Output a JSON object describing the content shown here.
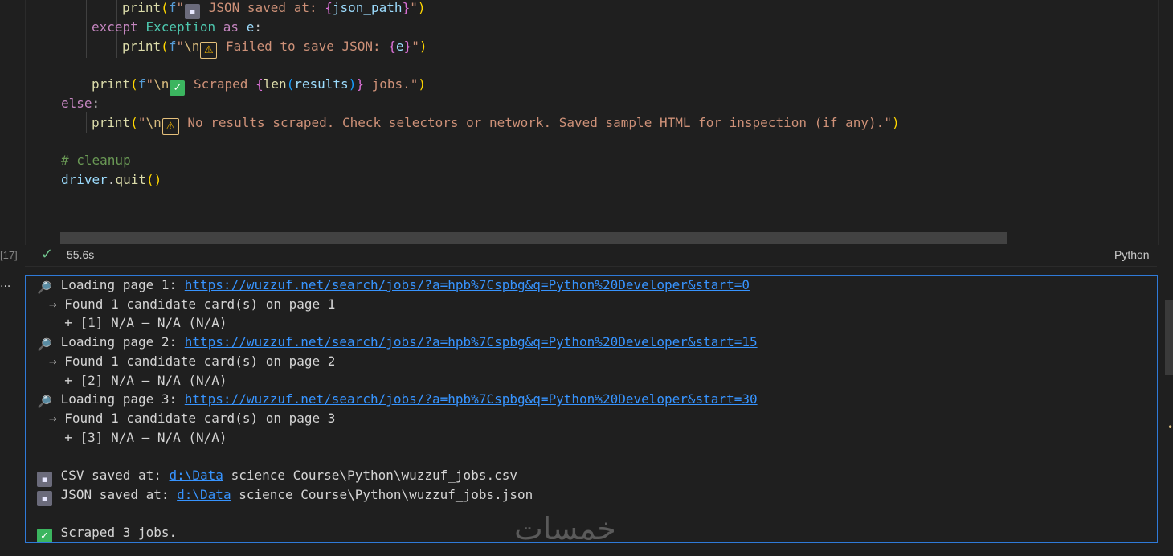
{
  "code": {
    "lines": [
      {
        "id": "json-saved-print"
      },
      {
        "id": "except-line"
      },
      {
        "id": "failed-print"
      },
      {
        "id": "scraped-print"
      },
      {
        "id": "else-line"
      },
      {
        "id": "no-results-print"
      },
      {
        "id": "comment-cleanup"
      },
      {
        "id": "driver-quit"
      }
    ],
    "t": {
      "print": "print",
      "f": "f",
      "json_saved_text": " JSON saved at: ",
      "json_path": "json_path",
      "except": "except",
      "Exception": "Exception",
      "as": "as",
      "e": "e",
      "failed_text": " Failed to save JSON: ",
      "scraped_text": " Scraped ",
      "len": "len",
      "results": "results",
      "jobs_text": " jobs.",
      "else": "else",
      "no_results_text": " No results scraped. Check selectors or network. Saved sample HTML for inspection (if any).",
      "comment": "# cleanup",
      "driver": "driver",
      "quit": "quit"
    }
  },
  "status": {
    "exec_count": "[17]",
    "duration": "55.6s",
    "language": "Python",
    "check_icon": "check-icon"
  },
  "more_actions": "...",
  "output": {
    "lines": [
      {
        "icon": "magnifier-icon",
        "prefix": "Loading page 1: ",
        "link": "https://wuzzuf.net/search/jobs/?a=hpb%7Cspbg&q=Python%20Developer&start=0",
        "suffix": ""
      },
      {
        "icon": "",
        "prefix": "→ Found 1 candidate card(s) on page 1",
        "link": "",
        "suffix": ""
      },
      {
        "icon": "",
        "prefix": "  + [1] N/A — N/A (N/A)",
        "link": "",
        "suffix": ""
      },
      {
        "icon": "magnifier-icon",
        "prefix": "Loading page 2: ",
        "link": "https://wuzzuf.net/search/jobs/?a=hpb%7Cspbg&q=Python%20Developer&start=15",
        "suffix": ""
      },
      {
        "icon": "",
        "prefix": "→ Found 1 candidate card(s) on page 2",
        "link": "",
        "suffix": ""
      },
      {
        "icon": "",
        "prefix": "  + [2] N/A — N/A (N/A)",
        "link": "",
        "suffix": ""
      },
      {
        "icon": "magnifier-icon",
        "prefix": "Loading page 3: ",
        "link": "https://wuzzuf.net/search/jobs/?a=hpb%7Cspbg&q=Python%20Developer&start=30",
        "suffix": ""
      },
      {
        "icon": "",
        "prefix": "→ Found 1 candidate card(s) on page 3",
        "link": "",
        "suffix": ""
      },
      {
        "icon": "",
        "prefix": "  + [3] N/A — N/A (N/A)",
        "link": "",
        "suffix": ""
      },
      {
        "icon": "",
        "prefix": "",
        "link": "",
        "suffix": ""
      },
      {
        "icon": "floppy-disk-icon",
        "prefix": "CSV saved at: ",
        "link": "d:\\Data",
        "suffix": " science Course\\Python\\wuzzuf_jobs.csv"
      },
      {
        "icon": "floppy-disk-icon",
        "prefix": "JSON saved at: ",
        "link": "d:\\Data",
        "suffix": " science Course\\Python\\wuzzuf_jobs.json"
      },
      {
        "icon": "",
        "prefix": "",
        "link": "",
        "suffix": ""
      },
      {
        "icon": "check-box-icon",
        "prefix": "Scraped 3 jobs.",
        "link": "",
        "suffix": ""
      }
    ]
  },
  "watermark": "خمسات",
  "colors": {
    "background": "#1f1f1f",
    "output_border": "#2f7ad8",
    "link": "#3794ff",
    "success": "#73c991"
  }
}
